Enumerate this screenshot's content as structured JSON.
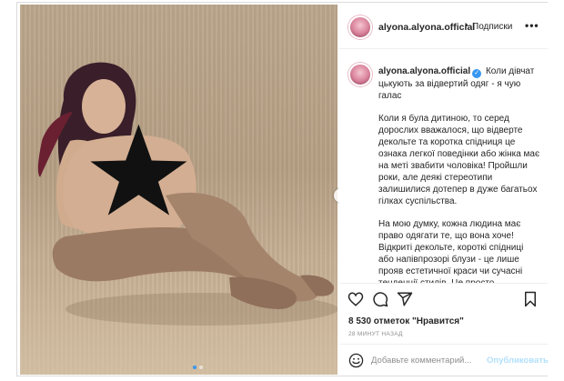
{
  "post": {
    "username": "alyona.alyona.official",
    "follow_label": "Подписки",
    "header_separator": "•",
    "more_label": "•••",
    "caption_title": "Коли дівчат цькують за відвертий одяг - я чую галас",
    "paragraphs": [
      "Коли я була дитиною, то серед дорослих вважалося, що відверте декольте та коротка спідниця це ознака легкої поведінки або жінка має на меті звабити чоловіка! Пройшли роки, але деякі стереотипи залишилися дотепер в дуже багатьох гілках суспільства.",
      "На мою думку, кожна людина має право одягати те, що вона хоче! Відкриті декольте, короткі спідниці або напівпрозорі блузи - це лише прояв естетичної краси чи сучасні тенденції стилів. Це просто"
    ],
    "likes": "8 530 отметок \"Нравится\"",
    "time": "28 МИНУТ НАЗАД",
    "comment_placeholder": "Добавьте комментарий...",
    "publish_label": "Опубликовать"
  },
  "icons": [
    "heart-icon",
    "comment-icon",
    "share-icon",
    "bookmark-icon",
    "smile-icon",
    "chevron-right-icon",
    "verified-icon"
  ],
  "colors": {
    "accent": "#3897f0",
    "publish_disabled": "#b2dffc",
    "muted": "#8e8e8e",
    "border": "#dbdbdb"
  },
  "carousel": {
    "slides": 2,
    "current": 1
  }
}
